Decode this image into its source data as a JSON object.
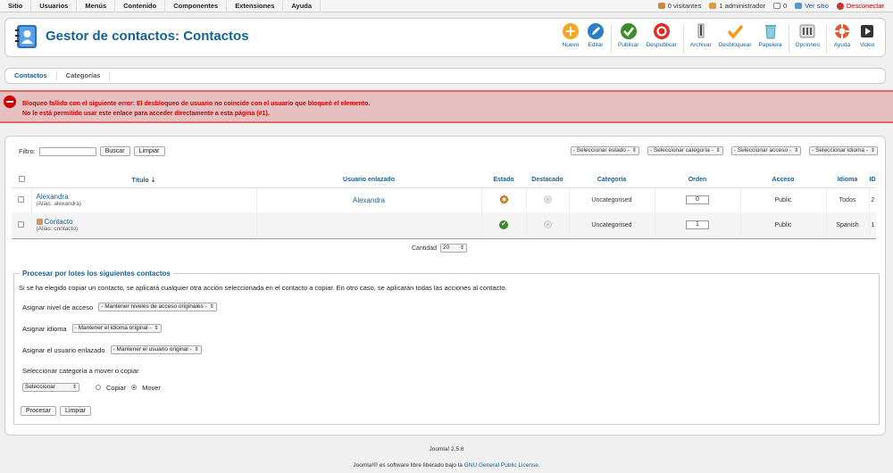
{
  "menu": [
    "Sitio",
    "Usuarios",
    "Menús",
    "Contenido",
    "Componentes",
    "Extensiones",
    "Ayuda"
  ],
  "status": {
    "visitors": "0 visitantes",
    "admins": "1 administrador",
    "messages": "0",
    "view_site": "Ver sitio",
    "logout": "Desconectar"
  },
  "header": {
    "title": "Gestor de contactos: Contactos"
  },
  "toolbar": {
    "new": "Nuevo",
    "edit": "Editar",
    "publish": "Publicar",
    "unpublish": "Despublicar",
    "archive": "Archivar",
    "checkin": "Desbloquear",
    "trash": "Papelera",
    "options": "Opciones",
    "help": "Ayuda",
    "video": "Video"
  },
  "subtabs": [
    "Contactos",
    "Categorías"
  ],
  "error": {
    "line1": "Bloqueo fallido con el siguiente error: El desbloqueo de usuario no coincide con el usuario que bloqueó el elemento.",
    "line2": "No le está permitido usar este enlace para acceder directamente a esta página (#1)."
  },
  "filter": {
    "label": "Filtro:",
    "search_btn": "Buscar",
    "clear_btn": "Limpiar",
    "selects": [
      "- Seleccionar estado -",
      "- Seleccionar categoría -",
      "- Seleccionar acceso -",
      "- Seleccionar idioma -"
    ]
  },
  "table": {
    "headers": {
      "title": "Título",
      "linked_user": "Usuario enlazado",
      "state": "Estado",
      "featured": "Destacado",
      "category": "Categoría",
      "order": "Orden",
      "access": "Acceso",
      "language": "Idioma",
      "id": "ID"
    },
    "rows": [
      {
        "title": "Alexandra",
        "alias": "(Alias: alexandra)",
        "linked_user": "Alexandra",
        "category": "Uncategorised",
        "order": "0",
        "access": "Public",
        "language": "Todos",
        "id": "2"
      },
      {
        "title": "Contacto",
        "alias": "(Alias: contacto)",
        "linked_user": "",
        "category": "Uncategorised",
        "order": "1",
        "access": "Public",
        "language": "Spanish",
        "id": "1"
      }
    ]
  },
  "pagination": {
    "label": "Cantidad",
    "value": "20"
  },
  "batch": {
    "title": "Procesar por lotes los siguientes contactos",
    "desc": "Si se ha elegido copiar un contacto, se aplicará cualquier otra acción seleccionada en el contacto a copiar. En otro caso, se aplicarán todas las acciones al contacto.",
    "access_label": "Asignar nivel de acceso",
    "access_value": "- Mantener niveles de acceso originales -",
    "lang_label": "Asignar idioma",
    "lang_value": "- Mantener el idioma original -",
    "user_label": "Asignar el usuario enlazado",
    "user_value": "- Mantener el usuario original -",
    "cat_label": "Seleccionar categoría a mover o copiar",
    "cat_value": "Seleccionar",
    "copy": "Copiar",
    "move": "Mover",
    "process_btn": "Procesar",
    "clear_btn": "Limpiar"
  },
  "footer": {
    "version": "Joomla! 2.5.6",
    "license_pre": "Joomla!® es software libre liberado bajo la ",
    "license_link": "GNU General Public License",
    "license_post": "."
  }
}
